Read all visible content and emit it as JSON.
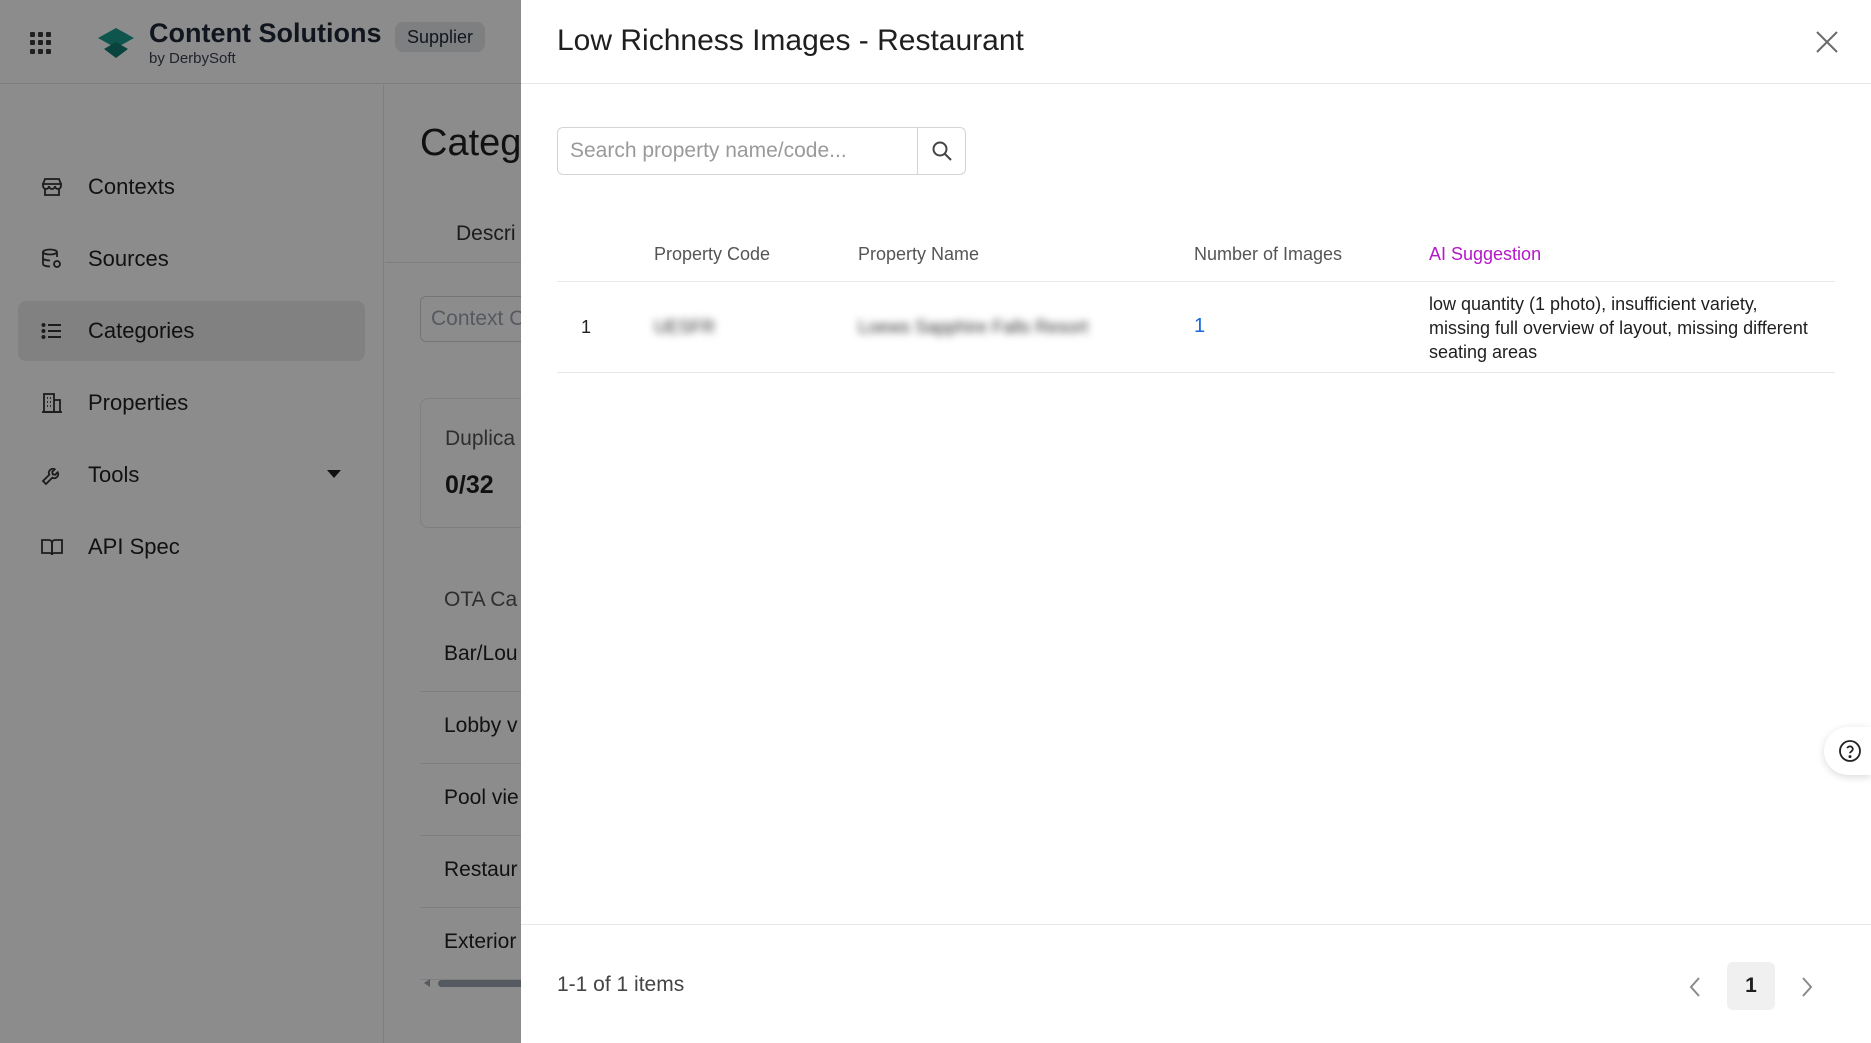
{
  "app": {
    "brand_title": "Content Solutions",
    "brand_sub": "by DerbySoft",
    "tag": "Supplier",
    "brand_color": "#1a9c8f"
  },
  "sidebar": {
    "items": [
      {
        "label": "Contexts",
        "icon": "store-icon"
      },
      {
        "label": "Sources",
        "icon": "database-gear-icon"
      },
      {
        "label": "Categories",
        "icon": "list-icon",
        "active": true
      },
      {
        "label": "Properties",
        "icon": "building-icon"
      },
      {
        "label": "Tools",
        "icon": "wrench-icon"
      },
      {
        "label": "API Spec",
        "icon": "book-icon"
      }
    ]
  },
  "main": {
    "title": "Categ",
    "tab": "Descri",
    "select_placeholder": "Context C",
    "card_label": "Duplica",
    "card_value": "0/32",
    "column_head": "OTA Ca",
    "rows": [
      "Bar/Lou",
      "Lobby v",
      "Pool vie",
      "Restaur",
      "Exterior"
    ]
  },
  "drawer": {
    "title": "Low Richness Images - Restaurant",
    "search_placeholder": "Search property name/code...",
    "columns": {
      "code": "Property Code",
      "name": "Property Name",
      "images": "Number of Images",
      "ai": "AI Suggestion"
    },
    "rows": [
      {
        "index": "1",
        "code": "UESFR",
        "name": "Loews Sapphire Falls Resort",
        "images": "1",
        "suggestion": "low quantity (1 photo), insufficient variety, missing full overview of layout, missing different seating areas"
      }
    ],
    "summary": "1-1 of 1 items",
    "current_page": "1",
    "ai_color": "#b517c9",
    "link_color": "#1668dc"
  }
}
